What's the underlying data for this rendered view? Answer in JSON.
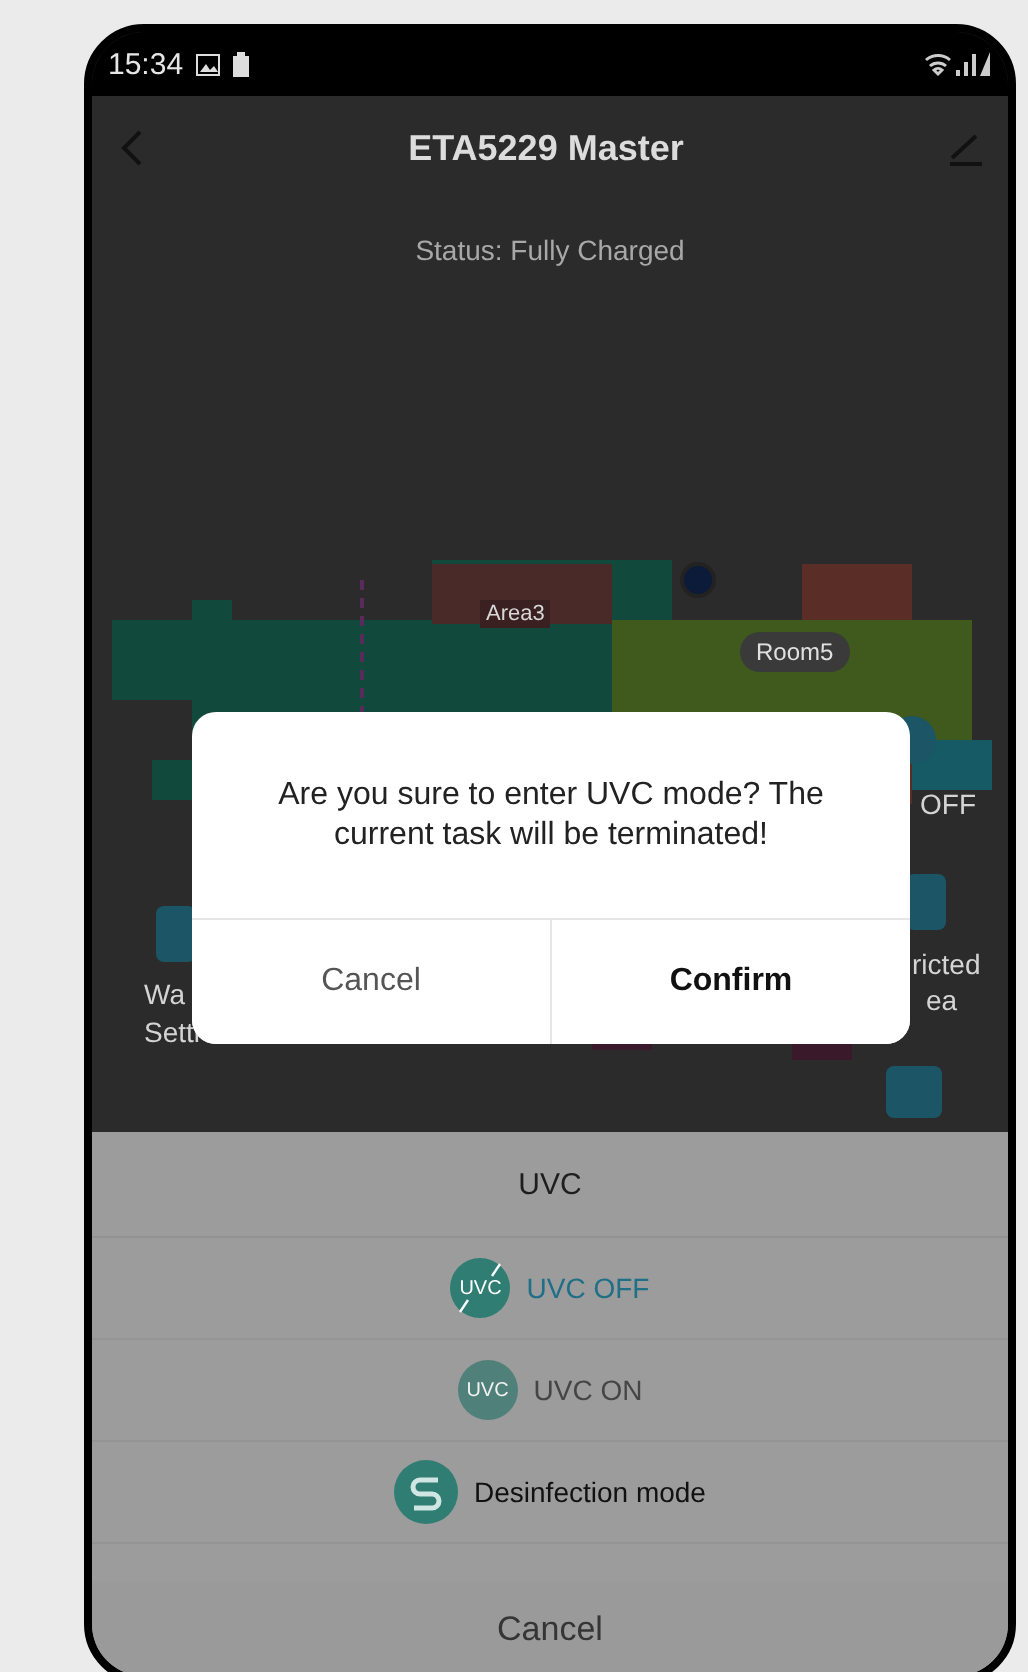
{
  "status_bar": {
    "time": "15:34"
  },
  "header": {
    "title": "ETA5229 Master"
  },
  "status": "Status: Fully Charged",
  "map": {
    "labels": [
      {
        "text": "Area3",
        "kind": "area"
      },
      {
        "text": "Room5",
        "kind": "room"
      }
    ]
  },
  "side_labels": {
    "left": [
      "Wa",
      "Setti"
    ],
    "right_top": "OFF",
    "right": [
      "ricted",
      "ea"
    ]
  },
  "dialog": {
    "message": "Are you sure to enter UVC mode? The current task will be terminated!",
    "buttons": [
      {
        "label": "Cancel",
        "kind": "cancel"
      },
      {
        "label": "Confirm",
        "kind": "confirm"
      }
    ]
  },
  "sheet": {
    "title": "UVC",
    "options": [
      {
        "label": "UVC OFF",
        "icon_text": "UVC",
        "kind": "uvc-off",
        "selected": true,
        "disabled": false
      },
      {
        "label": "UVC ON",
        "icon_text": "UVC",
        "kind": "uvc-on",
        "selected": false,
        "disabled": true
      },
      {
        "label": "Desinfection mode",
        "kind": "disinfection",
        "selected": false,
        "disabled": false
      }
    ],
    "cancel": "Cancel"
  }
}
